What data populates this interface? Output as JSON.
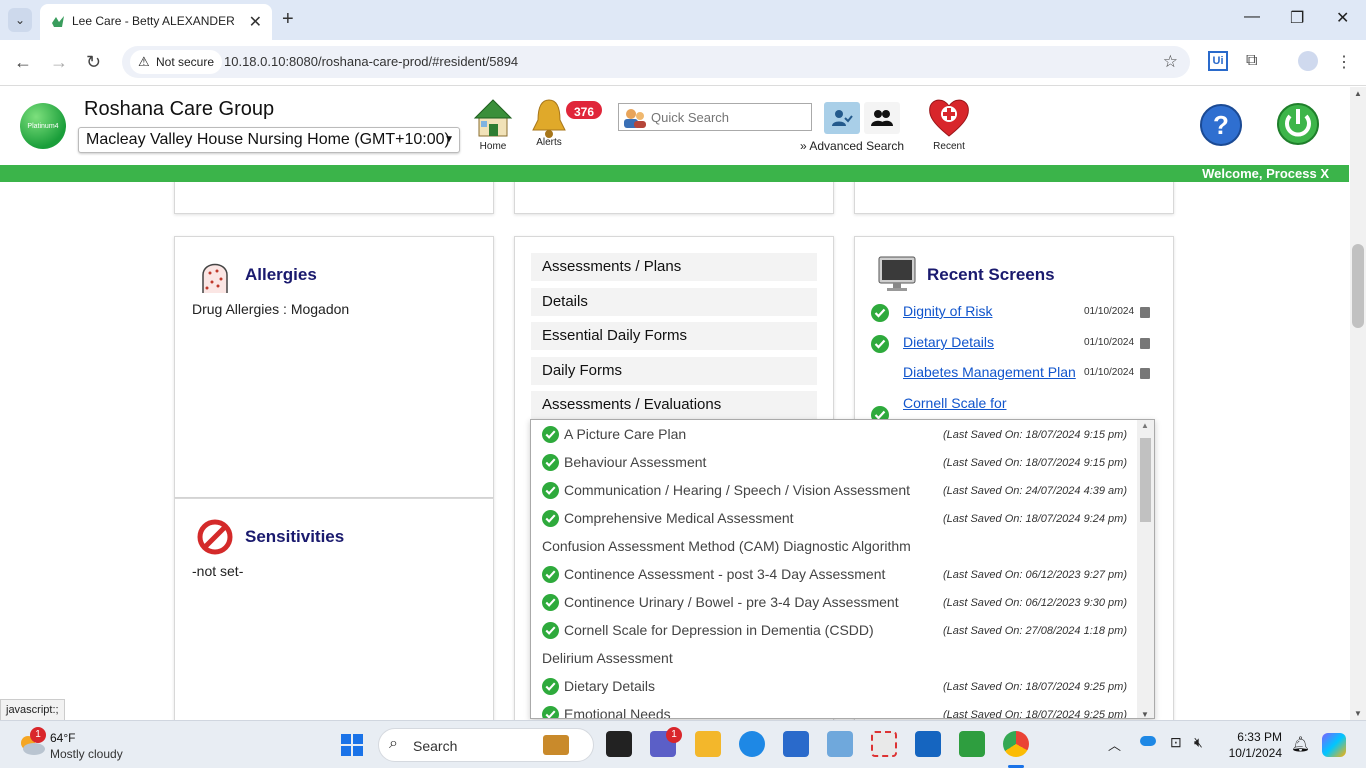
{
  "browser": {
    "tab_title": "Lee Care - Betty ALEXANDER",
    "security_label": "Not secure",
    "url": "10.18.0.10:8080/roshana-care-prod/#resident/5894",
    "status_text": "javascript:;"
  },
  "header": {
    "logo_text": "Platinum4",
    "org_name": "Roshana Care Group",
    "facility": "Macleay Valley House Nursing Home (GMT+10:00)",
    "home_label": "Home",
    "alerts_label": "Alerts",
    "alerts_count": "376",
    "search_placeholder": "Quick Search",
    "advanced_search_label": "Advanced Search",
    "recent_label": "Recent",
    "welcome": "Welcome, Process X"
  },
  "allergies": {
    "title": "Allergies",
    "text": "Drug Allergies : Mogadon"
  },
  "sensitivities": {
    "title": "Sensitivities",
    "text": "-not set-"
  },
  "menu": [
    {
      "label": "Assessments / Plans"
    },
    {
      "label": "Details"
    },
    {
      "label": "Essential Daily Forms"
    },
    {
      "label": "Daily Forms"
    },
    {
      "label": "Assessments / Evaluations"
    }
  ],
  "recent_screens": {
    "title": "Recent Screens",
    "items": [
      {
        "label": "Dignity of Risk",
        "date": "01/10/2024",
        "checked": true
      },
      {
        "label": "Dietary Details",
        "date": "01/10/2024",
        "checked": true
      },
      {
        "label": "Diabetes Management Plan",
        "date": "01/10/2024",
        "checked": false
      },
      {
        "label": "Cornell Scale for",
        "date": "",
        "checked": true
      }
    ]
  },
  "evaluations": [
    {
      "name": "A Picture Care Plan",
      "saved": "(Last Saved On: 18/07/2024 9:15 pm)",
      "checked": true
    },
    {
      "name": "Behaviour Assessment",
      "saved": "(Last Saved On: 18/07/2024 9:15 pm)",
      "checked": true
    },
    {
      "name": "Communication / Hearing / Speech / Vision Assessment",
      "saved": "(Last Saved On: 24/07/2024 4:39 am)",
      "checked": true
    },
    {
      "name": "Comprehensive Medical Assessment",
      "saved": "(Last Saved On: 18/07/2024 9:24 pm)",
      "checked": true
    },
    {
      "name": "Confusion Assessment Method (CAM) Diagnostic Algorithm",
      "saved": "",
      "checked": false
    },
    {
      "name": "Continence Assessment - post 3-4 Day Assessment",
      "saved": "(Last Saved On: 06/12/2023 9:27 pm)",
      "checked": true
    },
    {
      "name": "Continence Urinary / Bowel - pre 3-4 Day Assessment",
      "saved": "(Last Saved On: 06/12/2023 9:30 pm)",
      "checked": true
    },
    {
      "name": "Cornell Scale for Depression in Dementia (CSDD)",
      "saved": "(Last Saved On: 27/08/2024 1:18 pm)",
      "checked": true
    },
    {
      "name": "Delirium Assessment",
      "saved": "",
      "checked": false
    },
    {
      "name": "Dietary Details",
      "saved": "(Last Saved On: 18/07/2024 9:25 pm)",
      "checked": true
    },
    {
      "name": "Emotional Needs",
      "saved": "(Last Saved On: 18/07/2024 9:25 pm)",
      "checked": true
    }
  ],
  "taskbar": {
    "temperature": "64°F",
    "weather": "Mostly cloudy",
    "search_label": "Search",
    "time": "6:33 PM",
    "date": "10/1/2024",
    "weather_badge": "1",
    "teams_badge": "1"
  },
  "colors": {
    "accent_green": "#3bb44a",
    "title_navy": "#1a1a6e",
    "alert_red": "#e0263a",
    "link_blue": "#1155cc"
  }
}
